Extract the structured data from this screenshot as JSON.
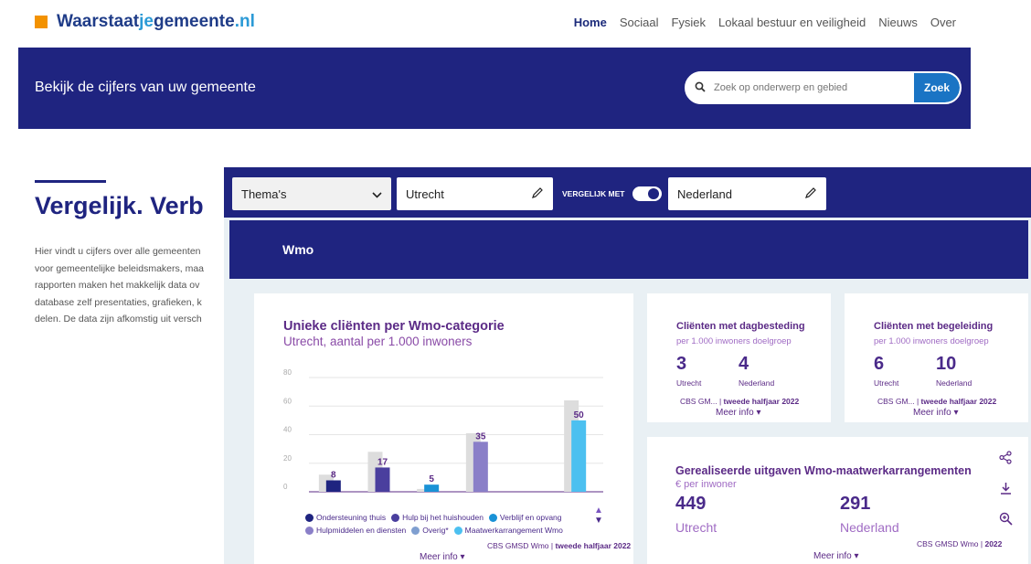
{
  "brand": {
    "part1": "Waarstaat",
    "part2": "je",
    "part3": "gemeente",
    "part4": ".nl",
    "accent": "#f39200",
    "primary": "#1f3c88",
    "secondary": "#2b9ad6"
  },
  "nav": {
    "items": [
      "Home",
      "Sociaal",
      "Fysiek",
      "Lokaal bestuur en veiligheid",
      "Nieuws",
      "Over"
    ],
    "active": "Home"
  },
  "hero": {
    "text": "Bekijk de cijfers van uw gemeente",
    "search_placeholder": "Zoek op onderwerp en gebied",
    "search_button": "Zoek",
    "search_icon": "search-icon",
    "color": "#1f2480"
  },
  "intro": {
    "title": "Vergelijk. Verb",
    "lines": [
      "Hier vindt u cijfers over alle gemeenten",
      "voor gemeentelijke beleidsmakers, maa",
      "rapporten maken het makkelijk data ov",
      "database zelf presentaties, grafieken, k",
      "delen. De data zijn afkomstig uit versch"
    ]
  },
  "filters": {
    "theme": "Thema's",
    "region": "Utrecht",
    "compare_label": "VERGELIJK MET",
    "compare_enabled": true,
    "compare_region": "Nederland"
  },
  "section": {
    "title": "Wmo"
  },
  "main_card": {
    "title": "Unieke cliënten per Wmo-categorie",
    "subtitle": "Utrecht, aantal per 1.000 inwoners",
    "legend": [
      {
        "name": "Ondersteuning thuis",
        "color": "#1f2480"
      },
      {
        "name": "Hulp bij het huishouden",
        "color": "#4a3f9e"
      },
      {
        "name": "Verblijf en opvang",
        "color": "#1a92d6"
      },
      {
        "name": "Hulpmiddelen en diensten",
        "color": "#8a7fc8"
      },
      {
        "name": "Overig*",
        "color": "#7f9fd0"
      },
      {
        "name": "Maatwerkarrangement Wmo",
        "color": "#4cc0f0"
      }
    ],
    "source_prefix": "CBS GMSD Wmo | ",
    "source_period": "tweede halfjaar 2022",
    "more": "Meer info ▾"
  },
  "chart_data": {
    "type": "bar",
    "categories": [
      "Ondersteuning thuis",
      "Hulp bij het huishouden",
      "Verblijf en opvang",
      "Hulpmiddelen en diensten",
      "Overig*",
      "Maatwerkarrangement Wmo"
    ],
    "series": [
      {
        "values": [
          12,
          28,
          2,
          41,
          null,
          64
        ],
        "color": "#dddddd"
      },
      {
        "values": [
          8,
          17,
          5,
          35,
          null,
          50
        ],
        "colors": [
          "#1f2480",
          "#4a3f9e",
          "#1a92d6",
          "#8a7fc8",
          "#7f9fd0",
          "#4cc0f0"
        ]
      }
    ],
    "data_labels": [
      "8",
      "17",
      "5",
      "35",
      "",
      "50"
    ],
    "ylim": [
      0,
      80
    ],
    "yticks": [
      "80",
      "60",
      "40",
      "20",
      "0"
    ],
    "grid": true
  },
  "kpi1": {
    "title": "Cliënten met dagbesteding",
    "subtitle": "per 1.000 inwoners doelgroep",
    "v1": "3",
    "l1": "Utrecht",
    "v2": "4",
    "l2": "Nederland",
    "source_prefix": "CBS GM... | ",
    "source_period": "tweede halfjaar 2022",
    "more": "Meer info ▾"
  },
  "kpi2": {
    "title": "Cliënten met begeleiding",
    "subtitle": "per 1.000 inwoners doelgroep",
    "v1": "6",
    "l1": "Utrecht",
    "v2": "10",
    "l2": "Nederland",
    "source_prefix": "CBS GM... | ",
    "source_period": "tweede halfjaar 2022",
    "more": "Meer info ▾"
  },
  "spend": {
    "title": "Gerealiseerde uitgaven Wmo-maatwerkarrangementen",
    "subtitle": "€ per inwoner",
    "v1": "449",
    "l1": "Utrecht",
    "v2": "291",
    "l2": "Nederland",
    "source_prefix": "CBS GMSD Wmo | ",
    "source_period": "2022",
    "more": "Meer info ▾"
  }
}
